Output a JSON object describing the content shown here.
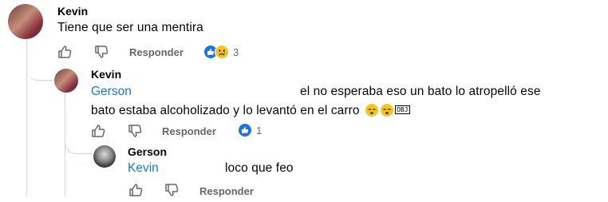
{
  "comments": [
    {
      "author": "Kevin",
      "text": "Tiene que ser una mentira",
      "actions": {
        "reply_label": "Responder"
      },
      "reactions": {
        "count": "3",
        "icons": [
          "like-icon",
          "sad-face-icon"
        ]
      }
    },
    {
      "author": "Kevin",
      "mention": "Gerson",
      "text_line1": "el no esperaba eso un bato lo atropelló ese",
      "text_line2": "bato estaba alcoholizado y lo levantó en el carro",
      "trailing_symbol": "OBJ",
      "actions": {
        "reply_label": "Responder"
      },
      "reactions": {
        "count": "1",
        "icons": [
          "like-icon"
        ]
      }
    },
    {
      "author": "Gerson",
      "mention": "Kevin",
      "text": "loco que feo",
      "actions": {
        "reply_label": "Responder"
      }
    }
  ],
  "colors": {
    "mention": "#1b74e4",
    "secondary_text": "#65676b",
    "like_blue": "#1b74e4",
    "emoji_yellow": "#f7c31f"
  }
}
